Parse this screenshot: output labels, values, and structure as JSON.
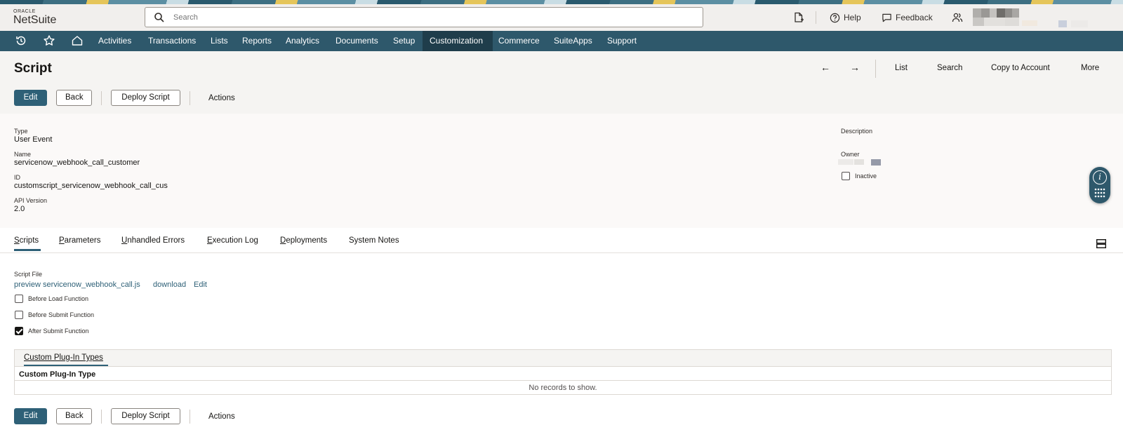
{
  "header": {
    "logo_top": "ORACLE",
    "logo_name": "NetSuite",
    "search_placeholder": "Search",
    "help_label": "Help",
    "feedback_label": "Feedback"
  },
  "nav": {
    "items": [
      "Activities",
      "Transactions",
      "Lists",
      "Reports",
      "Analytics",
      "Documents",
      "Setup",
      "Customization",
      "Commerce",
      "SuiteApps",
      "Support"
    ],
    "active": "Customization"
  },
  "page": {
    "title": "Script",
    "prev_arrow": "←",
    "next_arrow": "→",
    "links": [
      "List",
      "Search",
      "Copy to Account",
      "More"
    ]
  },
  "buttons": {
    "edit": "Edit",
    "back": "Back",
    "deploy": "Deploy Script",
    "actions": "Actions"
  },
  "fields": {
    "type_label": "Type",
    "type_value": "User Event",
    "name_label": "Name",
    "name_value": "servicenow_webhook_call_customer",
    "id_label": "ID",
    "id_value": "customscript_servicenow_webhook_call_cus",
    "api_label": "API Version",
    "api_value": "2.0",
    "description_label": "Description",
    "owner_label": "Owner",
    "inactive_label": "Inactive",
    "inactive_checked": false
  },
  "tabs": [
    {
      "first": "S",
      "rest": "cripts"
    },
    {
      "first": "P",
      "rest": "arameters"
    },
    {
      "first": "U",
      "rest": "nhandled Errors"
    },
    {
      "first": "E",
      "rest": "xecution Log"
    },
    {
      "first": "D",
      "rest": "eployments"
    },
    {
      "first": "",
      "rest": "System Notes"
    }
  ],
  "active_tab": "Scripts",
  "script_tab": {
    "file_label": "Script File",
    "preview_link": "preview servicenow_webhook_call.js",
    "download_link": "download",
    "edit_link": "Edit",
    "before_load": {
      "label": "Before Load Function",
      "checked": false
    },
    "before_submit": {
      "label": "Before Submit Function",
      "checked": false
    },
    "after_submit": {
      "label": "After Submit Function",
      "checked": true
    }
  },
  "sublist": {
    "tab_label": "Custom Plug-In Types",
    "column": "Custom Plug-In Type",
    "empty_text": "No records to show."
  },
  "colors": {
    "nav_bg": "#2e586b",
    "nav_active": "#1f3d4b",
    "primary_button": "#2e6077",
    "link": "#2e6077"
  }
}
